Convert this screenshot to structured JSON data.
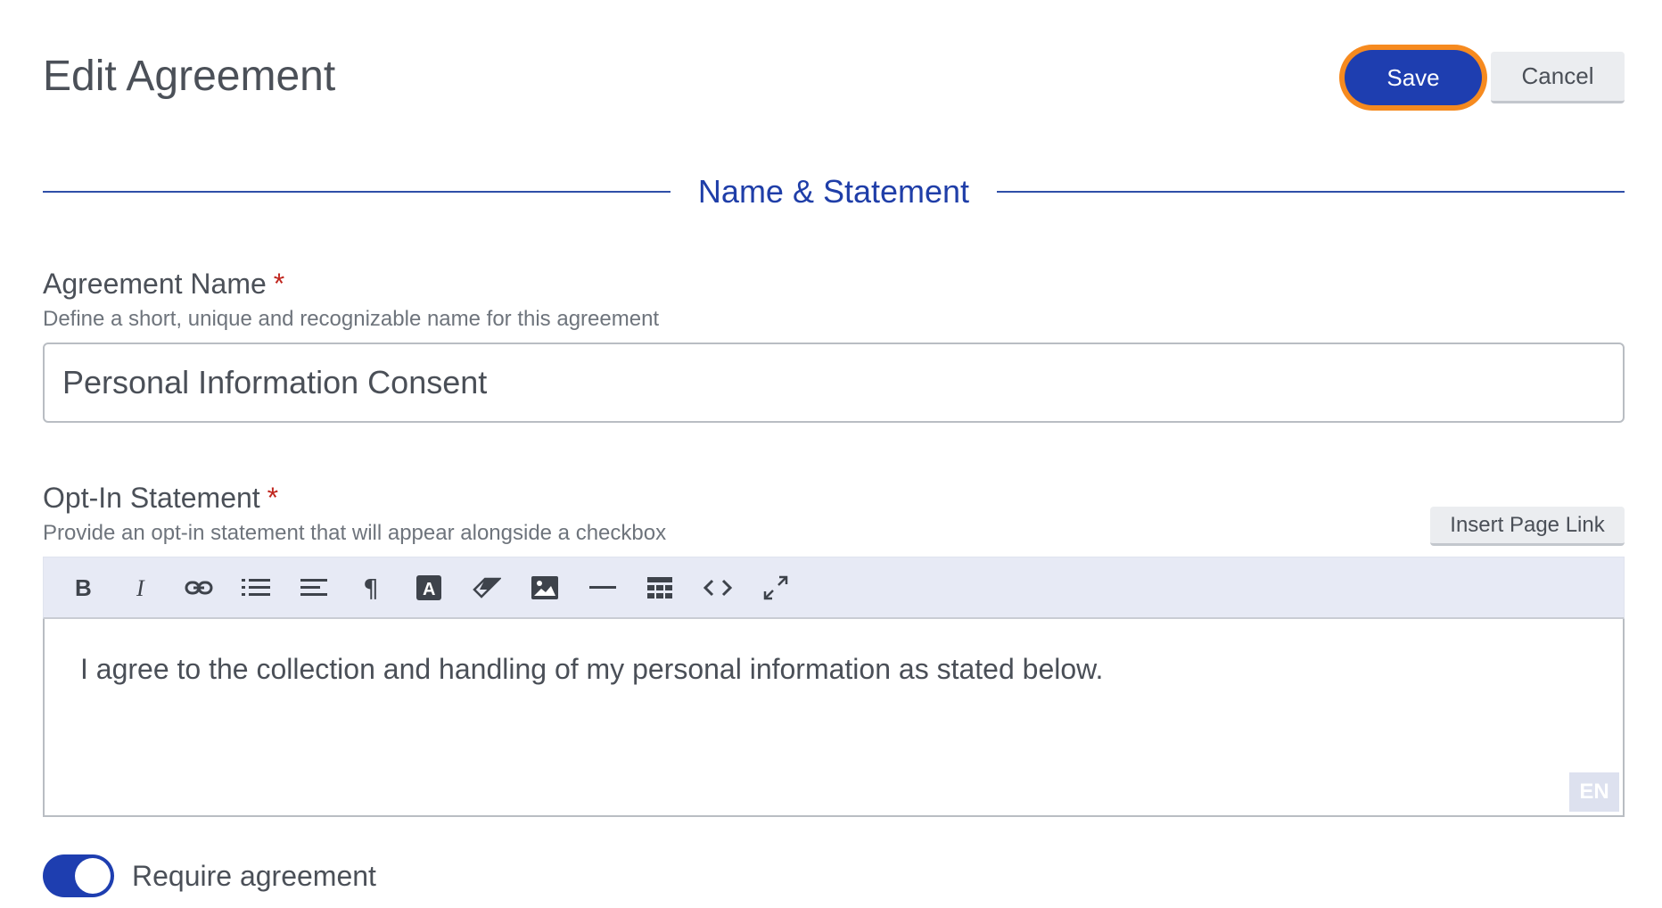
{
  "header": {
    "title": "Edit Agreement",
    "save_label": "Save",
    "cancel_label": "Cancel"
  },
  "section": {
    "title": "Name & Statement"
  },
  "agreement_name": {
    "label": "Agreement Name",
    "required_mark": "*",
    "help": "Define a short, unique and recognizable name for this agreement",
    "value": "Personal Information Consent"
  },
  "opt_in": {
    "label": "Opt-In Statement",
    "required_mark": "*",
    "help": "Provide an opt-in statement that will appear alongside a checkbox",
    "insert_link_label": "Insert Page Link",
    "toolbar": [
      "bold-icon",
      "italic-icon",
      "link-icon",
      "bulleted-list-icon",
      "align-icon",
      "paragraph-icon",
      "font-color-icon",
      "eraser-icon",
      "image-icon",
      "horizontal-rule-icon",
      "table-icon",
      "code-view-icon",
      "fullscreen-icon"
    ],
    "content": "I agree to the collection and handling of my personal information as stated below.",
    "language_badge": "EN"
  },
  "require_agreement": {
    "label": "Require agreement",
    "enabled": true
  },
  "colors": {
    "primary": "#1e3eb0",
    "focus_ring": "#f68a1f",
    "required": "#c0261e",
    "section": "#1f3ea8"
  }
}
